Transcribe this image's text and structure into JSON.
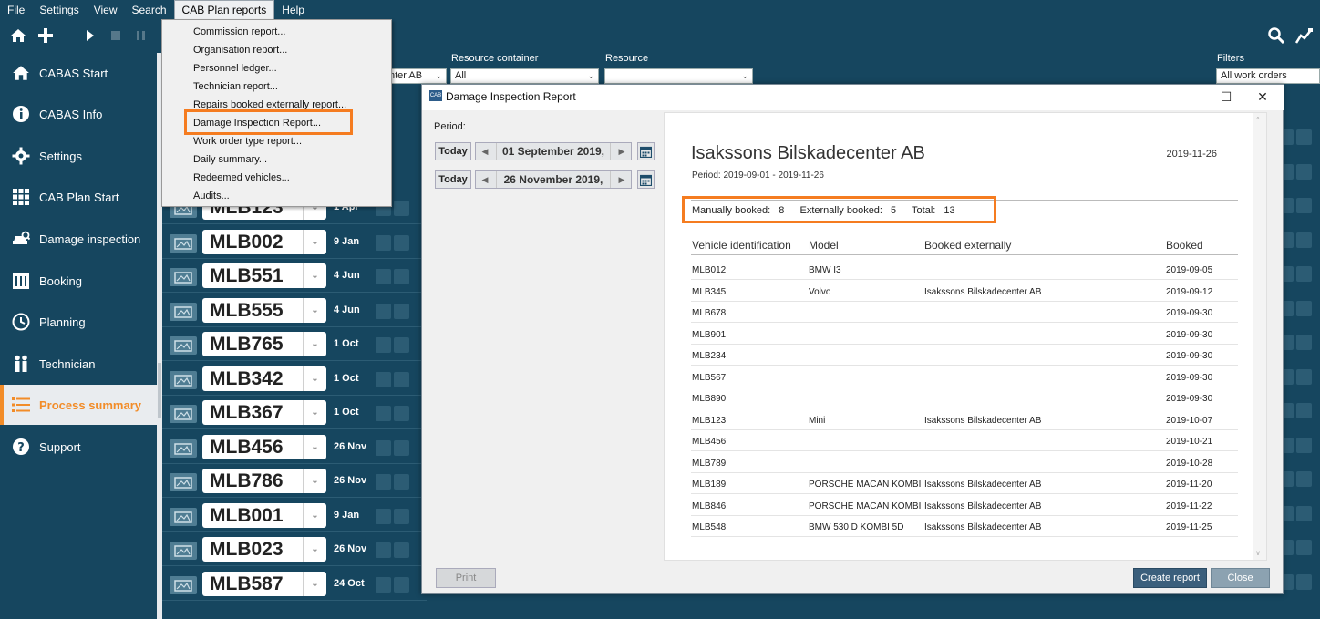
{
  "menubar": {
    "items": [
      "File",
      "Settings",
      "View",
      "Search",
      "CAB Plan reports",
      "Help"
    ]
  },
  "sidebar": {
    "items": [
      {
        "label": "CABAS Start",
        "icon": "home-icon"
      },
      {
        "label": "CABAS Info",
        "icon": "info-icon"
      },
      {
        "label": "Settings",
        "icon": "gear-icon"
      },
      {
        "label": "CAB Plan Start",
        "icon": "grid-icon"
      },
      {
        "label": "Damage inspection",
        "icon": "car-search-icon"
      },
      {
        "label": "Booking",
        "icon": "calendar-grid-icon"
      },
      {
        "label": "Planning",
        "icon": "clock-icon"
      },
      {
        "label": "Technician",
        "icon": "people-icon"
      },
      {
        "label": "Process summary",
        "icon": "list-icon"
      },
      {
        "label": "Support",
        "icon": "help-icon"
      }
    ],
    "active_index": 8
  },
  "filters": {
    "resource_container_label": "Resource container",
    "resource_container_value": "All",
    "resource_label": "Resource",
    "resource_value": "",
    "partial_value": "nter AB",
    "filters_label": "Filters",
    "filters_value": "All work orders"
  },
  "rows": [
    {
      "plate": "MLB123",
      "date": "1 Apr"
    },
    {
      "plate": "MLB002",
      "date": "9 Jan"
    },
    {
      "plate": "MLB551",
      "date": "4 Jun"
    },
    {
      "plate": "MLB555",
      "date": "4 Jun"
    },
    {
      "plate": "MLB765",
      "date": "1 Oct"
    },
    {
      "plate": "MLB342",
      "date": "1 Oct"
    },
    {
      "plate": "MLB367",
      "date": "1 Oct"
    },
    {
      "plate": "MLB456",
      "date": "26 Nov"
    },
    {
      "plate": "MLB786",
      "date": "26 Nov"
    },
    {
      "plate": "MLB001",
      "date": "9 Jan"
    },
    {
      "plate": "MLB023",
      "date": "26 Nov"
    },
    {
      "plate": "MLB587",
      "date": "24 Oct"
    }
  ],
  "reports_menu": {
    "items": [
      "Commission report...",
      "Organisation report...",
      "Personnel ledger...",
      "Technician report...",
      "Repairs booked externally report...",
      "Damage Inspection Report...",
      "Work order type report...",
      "Daily summary...",
      "Redeemed vehicles...",
      "Audits..."
    ],
    "highlighted_index": 5
  },
  "dialog": {
    "title": "Damage Inspection Report",
    "app_icon_text": "CAB",
    "period_label": "Period:",
    "today_label": "Today",
    "from_date": "01 September 2019,",
    "to_date": "26 November 2019,",
    "print_label": "Print",
    "create_label": "Create report",
    "close_label": "Close"
  },
  "report": {
    "company": "Isakssons Bilskadecenter AB",
    "date": "2019-11-26",
    "period": "Period: 2019-09-01 - 2019-11-26",
    "manually_label": "Manually booked:",
    "manually_value": "8",
    "externally_label": "Externally booked:",
    "externally_value": "5",
    "total_label": "Total:",
    "total_value": "13",
    "headers": [
      "Vehicle identification",
      "Model",
      "Booked externally",
      "Booked"
    ],
    "rows": [
      {
        "vehicle": "MLB012",
        "model": "BMW I3",
        "external": "",
        "booked": "2019-09-05"
      },
      {
        "vehicle": "MLB345",
        "model": "Volvo",
        "external": "Isakssons Bilskadecenter AB",
        "booked": "2019-09-12"
      },
      {
        "vehicle": "MLB678",
        "model": "",
        "external": "",
        "booked": "2019-09-30"
      },
      {
        "vehicle": "MLB901",
        "model": "",
        "external": "",
        "booked": "2019-09-30"
      },
      {
        "vehicle": "MLB234",
        "model": "",
        "external": "",
        "booked": "2019-09-30"
      },
      {
        "vehicle": "MLB567",
        "model": "",
        "external": "",
        "booked": "2019-09-30"
      },
      {
        "vehicle": "MLB890",
        "model": "",
        "external": "",
        "booked": "2019-09-30"
      },
      {
        "vehicle": "MLB123",
        "model": "Mini",
        "external": "Isakssons Bilskadecenter AB",
        "booked": "2019-10-07"
      },
      {
        "vehicle": "MLB456",
        "model": "",
        "external": "",
        "booked": "2019-10-21"
      },
      {
        "vehicle": "MLB789",
        "model": "",
        "external": "",
        "booked": "2019-10-28"
      },
      {
        "vehicle": "MLB189",
        "model": "PORSCHE MACAN KOMBI",
        "external": "Isakssons Bilskadecenter AB",
        "booked": "2019-11-20"
      },
      {
        "vehicle": "MLB846",
        "model": "PORSCHE MACAN KOMBI",
        "external": "Isakssons Bilskadecenter AB",
        "booked": "2019-11-22"
      },
      {
        "vehicle": "MLB548",
        "model": "BMW 530 D KOMBI 5D",
        "external": "Isakssons Bilskadecenter AB",
        "booked": "2019-11-25"
      }
    ]
  },
  "colors": {
    "background": "#16465f",
    "accent": "#f57c20",
    "primary_button": "#3b5f7c"
  }
}
